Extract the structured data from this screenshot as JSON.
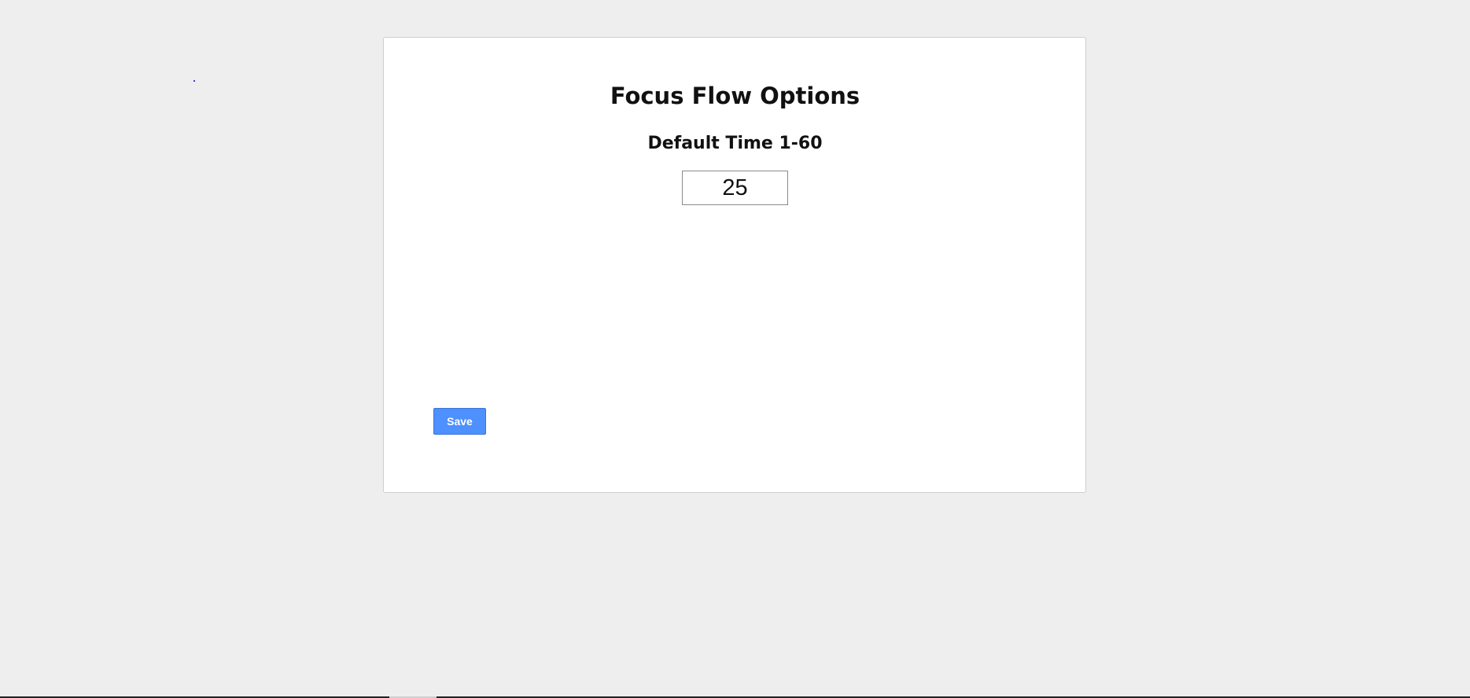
{
  "options": {
    "title": "Focus Flow Options",
    "default_time_label": "Default Time 1-60",
    "default_time_value": "25",
    "save_label": "Save"
  },
  "colors": {
    "page_background": "#eeeeee",
    "card_background": "#ffffff",
    "save_button": "#4d90fe"
  }
}
